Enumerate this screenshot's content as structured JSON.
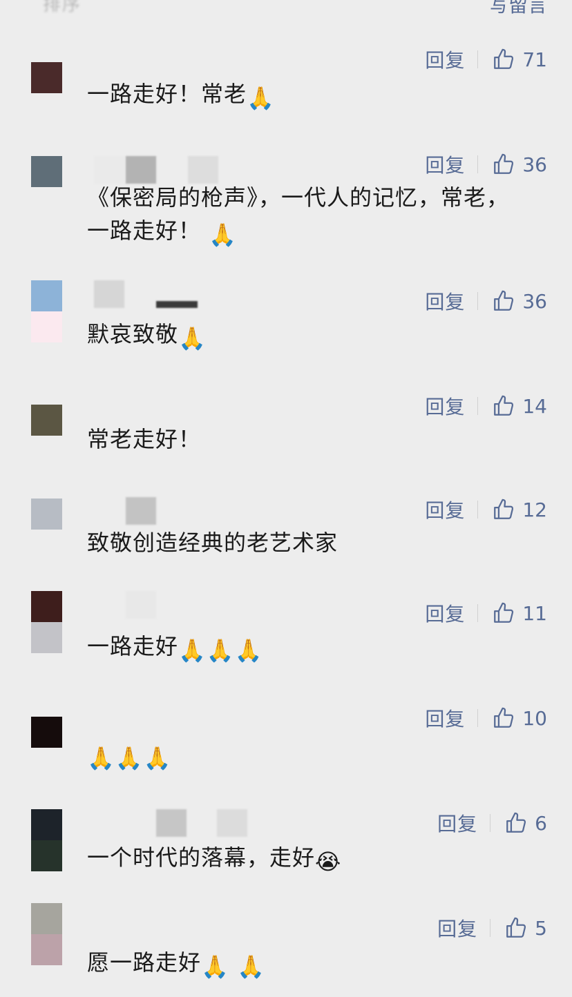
{
  "header": {
    "left_text": "排序",
    "write_comment": "写留言"
  },
  "reply_label": "回复",
  "comments": [
    {
      "avatar_colors": [
        "#4a2a2a"
      ],
      "likes": "71",
      "text": "一路走好！常老",
      "emoji": [
        "🙏"
      ]
    },
    {
      "avatar_colors": [
        "#5f6e78"
      ],
      "likes": "36",
      "text": "《保密局的枪声》，一代人的记忆，常老，一路走好！",
      "emoji": [
        "🙏"
      ]
    },
    {
      "avatar_colors": [
        "#8db3d8",
        "#fbe9ef"
      ],
      "likes": "36",
      "text": "默哀致敬",
      "emoji": [
        "🙏"
      ]
    },
    {
      "avatar_colors": [
        "#5b5643"
      ],
      "likes": "14",
      "text": "常老走好！",
      "emoji": []
    },
    {
      "avatar_colors": [
        "#b7bcc4"
      ],
      "likes": "12",
      "text": "致敬创造经典的老艺术家",
      "emoji": []
    },
    {
      "avatar_colors": [
        "#3e1e1c",
        "#c3c3c8"
      ],
      "likes": "11",
      "text": "一路走好",
      "emoji": [
        "🙏",
        "🙏",
        "🙏"
      ]
    },
    {
      "avatar_colors": [
        "#150c0c"
      ],
      "likes": "10",
      "text": "",
      "emoji": [
        "🙏",
        "🙏",
        "🙏"
      ]
    },
    {
      "avatar_colors": [
        "#1d232a",
        "#26332b"
      ],
      "likes": "6",
      "text": "一个时代的落幕，走好",
      "emoji": [
        "😭"
      ]
    },
    {
      "avatar_colors": [
        "#a6a59e",
        "#bca2a9"
      ],
      "likes": "5",
      "text": "愿一路走好",
      "emoji": [
        "🙏",
        "🙏"
      ]
    }
  ],
  "icons": {
    "like": "thumbs-up-icon",
    "pray": "folded-hands-emoji",
    "cry": "loudly-crying-emoji"
  },
  "colors": {
    "background": "#ededed",
    "link": "#576b95",
    "text": "#1a1a1a"
  }
}
